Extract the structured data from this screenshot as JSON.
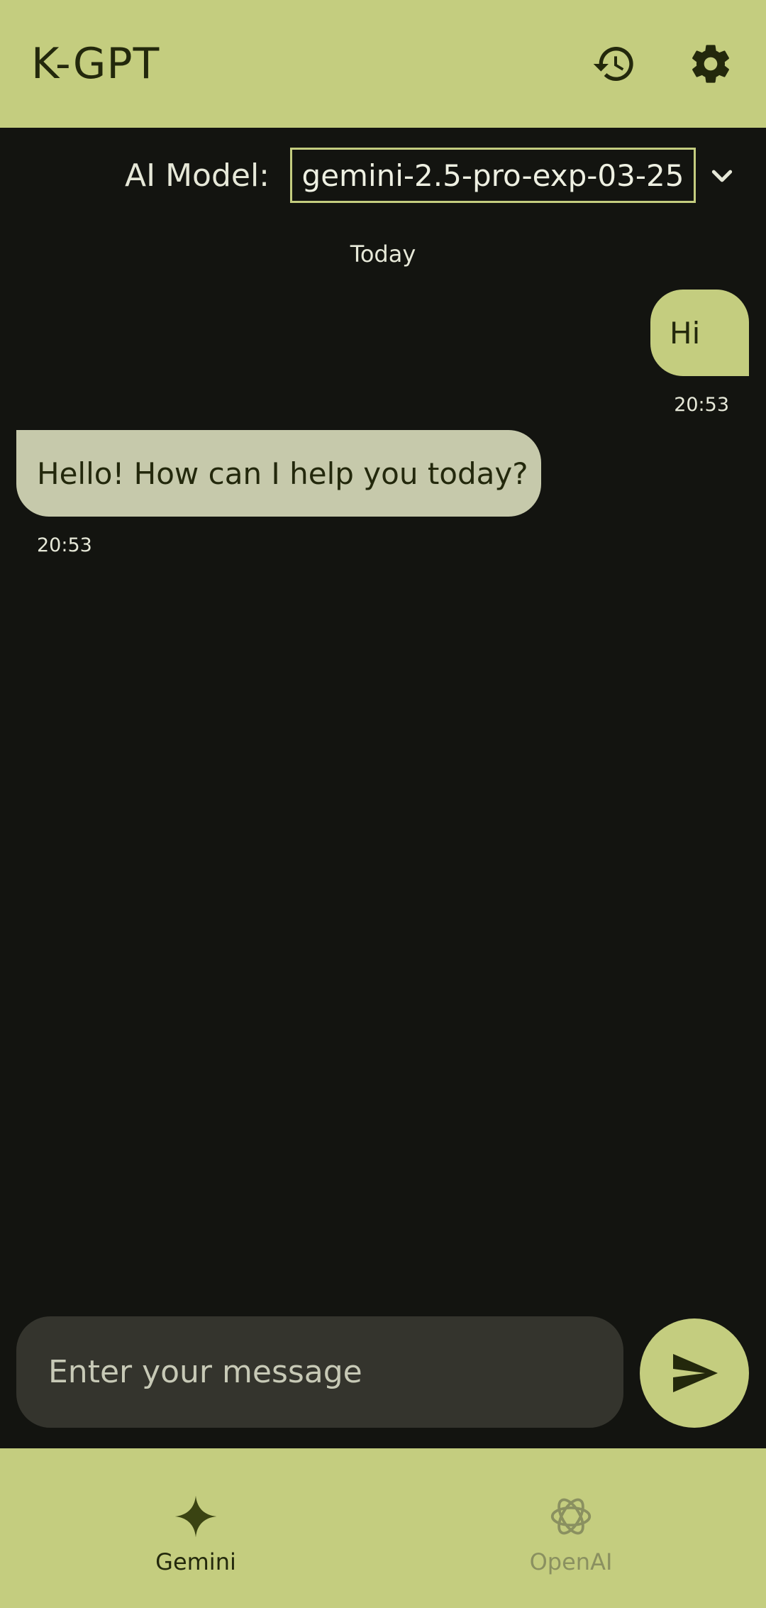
{
  "app": {
    "title": "K-GPT"
  },
  "header": {
    "history_icon": "history-icon",
    "settings_icon": "gear-icon"
  },
  "model_selector": {
    "label": "AI Model:",
    "selected": "gemini-2.5-pro-exp-03-25",
    "dropdown_icon": "chevron-down-icon"
  },
  "chat": {
    "date_separator": "Today",
    "messages": [
      {
        "role": "user",
        "text": "Hi",
        "time": "20:53"
      },
      {
        "role": "assistant",
        "text": "Hello! How can I help you today?",
        "time": "20:53"
      }
    ]
  },
  "composer": {
    "placeholder": "Enter your message",
    "value": "",
    "send_icon": "send-icon"
  },
  "bottom_nav": {
    "items": [
      {
        "label": "Gemini",
        "icon": "sparkle-icon",
        "active": true
      },
      {
        "label": "OpenAI",
        "icon": "openai-icon",
        "active": false
      }
    ]
  },
  "colors": {
    "accent": "#c4cd7f",
    "background": "#131410",
    "assistant_bubble": "#c6c9ab",
    "composer": "#34342d",
    "on_accent": "#23280c"
  }
}
